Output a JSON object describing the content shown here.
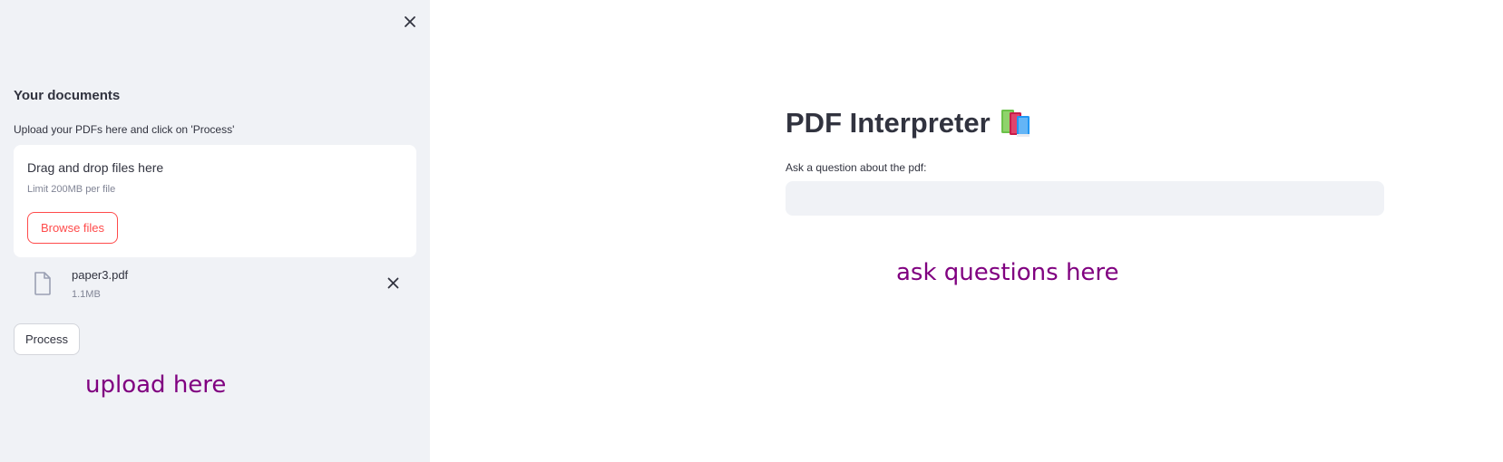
{
  "sidebar": {
    "heading": "Your documents",
    "upload_label": "Upload your PDFs here and click on 'Process'",
    "dropzone": {
      "title": "Drag and drop files here",
      "limit": "Limit 200MB per file",
      "browse_label": "Browse files"
    },
    "file": {
      "name": "paper3.pdf",
      "size": "1.1MB"
    },
    "process_label": "Process",
    "annotation": "upload here"
  },
  "main": {
    "title": "PDF Interpreter",
    "title_icon": "books-emoji",
    "question_label": "Ask a question about the pdf:",
    "question_value": "",
    "annotation": "ask questions here"
  },
  "colors": {
    "sidebar_bg": "#f0f2f6",
    "accent": "#ff4b4b",
    "annotation": "#800080",
    "text": "#31333f",
    "muted": "#808495"
  }
}
